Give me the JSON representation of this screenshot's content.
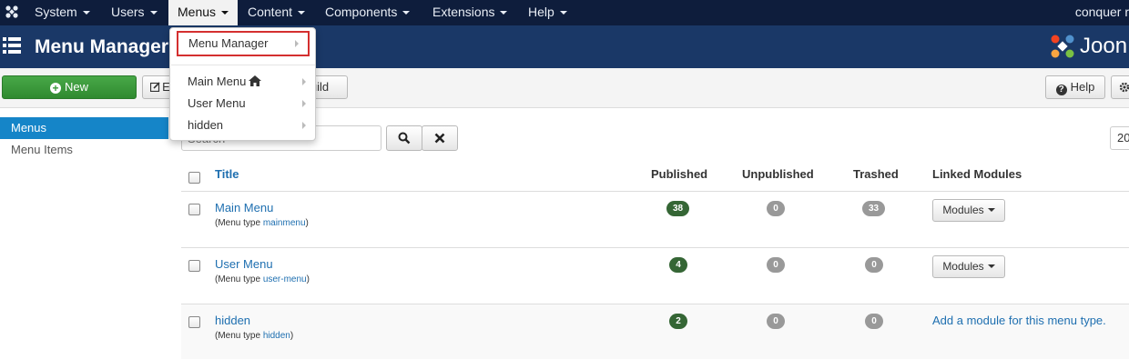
{
  "navbar": {
    "items": [
      {
        "label": "System"
      },
      {
        "label": "Users"
      },
      {
        "label": "Menus",
        "active": true
      },
      {
        "label": "Content"
      },
      {
        "label": "Components"
      },
      {
        "label": "Extensions"
      },
      {
        "label": "Help"
      }
    ],
    "user": "conquer r"
  },
  "header": {
    "title": "Menu Manager: M",
    "brand": "Joon"
  },
  "toolbar": {
    "new_label": "New",
    "edit_label": "E",
    "rebuild_label": "uild",
    "help_label": "Help"
  },
  "sidebar": {
    "items": [
      {
        "label": "Menus",
        "active": true
      },
      {
        "label": "Menu Items"
      }
    ]
  },
  "search": {
    "placeholder": "Search",
    "limit": "20"
  },
  "table": {
    "headers": {
      "title": "Title",
      "published": "Published",
      "unpublished": "Unpublished",
      "trashed": "Trashed",
      "linked_modules": "Linked Modules"
    },
    "menu_type_prefix": "(Menu type ",
    "menu_type_suffix": ")",
    "rows": [
      {
        "title": "Main Menu",
        "menutype": "mainmenu",
        "published": "38",
        "unpublished": "0",
        "trashed": "33",
        "modules_label": "Modules"
      },
      {
        "title": "User Menu",
        "menutype": "user-menu",
        "published": "4",
        "unpublished": "0",
        "trashed": "0",
        "modules_label": "Modules"
      },
      {
        "title": "hidden",
        "menutype": "hidden",
        "published": "2",
        "unpublished": "0",
        "trashed": "0",
        "add_module_text": "Add a module for this menu type."
      }
    ]
  },
  "dropdown": {
    "items": [
      {
        "label": "Menu Manager",
        "highlighted": true
      },
      {
        "label": "Main Menu",
        "home": true
      },
      {
        "label": "User Menu"
      },
      {
        "label": "hidden"
      }
    ]
  },
  "colors": {
    "navbar": "#0e1d3c",
    "header": "#1a3867",
    "accent": "#1585c8",
    "success": "#356635",
    "highlight": "#d42f2f"
  }
}
